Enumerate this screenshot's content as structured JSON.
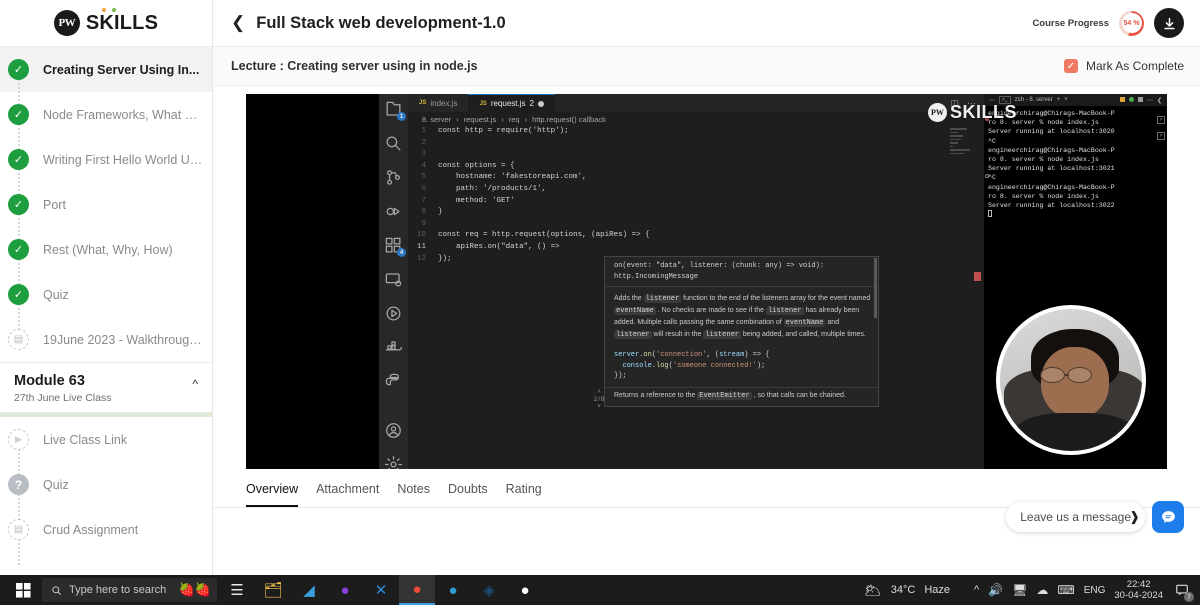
{
  "brand": {
    "mark": "PW",
    "name": "SKILLS"
  },
  "sidebar": {
    "lessons": [
      {
        "label": "Creating Server Using In...",
        "state": "done",
        "active": true
      },
      {
        "label": "Node Frameworks, What & W...",
        "state": "done",
        "active": false
      },
      {
        "label": "Writing First Hello World Usin...",
        "state": "done",
        "active": false
      },
      {
        "label": "Port",
        "state": "done",
        "active": false
      },
      {
        "label": "Rest (What, Why, How)",
        "state": "done",
        "active": false
      },
      {
        "label": "Quiz",
        "state": "done",
        "active": false
      },
      {
        "label": "19June 2023 - Walkthrough...",
        "state": "doc",
        "active": false
      }
    ],
    "module": {
      "title": "Module 63",
      "subtitle": "27th June Live Class",
      "collapse_icon": "chevron-up-icon"
    },
    "module_items": [
      {
        "label": "Live Class Link",
        "state": "play"
      },
      {
        "label": "Quiz",
        "state": "quiz"
      },
      {
        "label": "Crud Assignment",
        "state": "doc"
      }
    ]
  },
  "topbar": {
    "back_icon": "chevron-left-icon",
    "course_title": "Full Stack web development-1.0",
    "progress_label": "Course Progress",
    "progress_value": "54 %",
    "progress_percent": 54,
    "progress_color": "#e8543f",
    "download_icon": "download-icon"
  },
  "lecturebar": {
    "text": "Lecture : Creating server using in node.js",
    "mark_label": "Mark As Complete",
    "mark_checked": true,
    "mark_color": "#ef7a63"
  },
  "video": {
    "activity_icons": [
      {
        "name": "explorer-icon",
        "badge": "1"
      },
      {
        "name": "search-icon",
        "badge": ""
      },
      {
        "name": "source-control-icon",
        "badge": ""
      },
      {
        "name": "run-debug-icon",
        "badge": ""
      },
      {
        "name": "extensions-icon",
        "badge": "4"
      },
      {
        "name": "remote-explorer-icon",
        "badge": ""
      },
      {
        "name": "testing-icon",
        "badge": ""
      },
      {
        "name": "docker-icon",
        "badge": ""
      },
      {
        "name": "python-icon",
        "badge": ""
      }
    ],
    "activity_bottom": [
      {
        "name": "account-icon"
      },
      {
        "name": "settings-gear-icon"
      }
    ],
    "editor_tabs": [
      {
        "label": "index.js",
        "icon": "js-file-icon",
        "active": false,
        "dirty": false,
        "count": ""
      },
      {
        "label": "request.js",
        "icon": "js-file-icon",
        "active": true,
        "dirty": true,
        "count": "2"
      }
    ],
    "editor_actions": [
      {
        "name": "split-editor-icon",
        "glyph": "◫"
      },
      {
        "name": "more-actions-icon",
        "glyph": "⋯"
      }
    ],
    "breadcrumb": [
      "8. server",
      "request.js",
      "req",
      "http.request() callback"
    ],
    "code_lines": [
      {
        "n": "1",
        "text": "const http = require('http');"
      },
      {
        "n": "2",
        "text": ""
      },
      {
        "n": "3",
        "text": ""
      },
      {
        "n": "4",
        "text": "const options = {"
      },
      {
        "n": "5",
        "text": "    hostname: 'fakestoreapi.com',"
      },
      {
        "n": "6",
        "text": "    path: '/products/1',"
      },
      {
        "n": "7",
        "text": "    method: 'GET'"
      },
      {
        "n": "8",
        "text": "}"
      },
      {
        "n": "9",
        "text": ""
      },
      {
        "n": "10",
        "text": "const req = http.request(options, (apiRes) => {"
      },
      {
        "n": "11",
        "text": "    apiRes.on(\"data\", () => "
      },
      {
        "n": "12",
        "text": "});"
      }
    ],
    "tooltip": {
      "signature": "on(event: \"data\", listener: (chunk: any) => void):",
      "signature2": "http.IncomingMessage",
      "description": "Adds the listener function to the end of the listeners array for the event named eventName . No checks are made to see if the listener has already been added. Multiple calls passing the same combination of eventName and listener will result in the listener being added, and called, multiple times.",
      "example_line1": "server.on('connection', (stream) => {",
      "example_line2": "  console.log('someone connected!');",
      "example_line3": "});",
      "footer": "Returns a reference to the EventEmitter , so that calls can be chained.",
      "pager": "2/8"
    },
    "terminal": {
      "title": "zsh - 8. server",
      "prompt_icon": "terminal-icon",
      "add_icon": "plus-icon",
      "lines": [
        "engineerchirag@Chirags-MacBook-P",
        "ro 8. server % node index.js",
        "Server running at localhost:3020",
        "^C",
        "engineerchirag@Chirags-MacBook-P",
        "ro 8. server % node index.js",
        "Server running at localhost:3021",
        "^C",
        "engineerchirag@Chirags-MacBook-P",
        "ro 8. server % node index.js",
        "Server running at localhost:3022"
      ]
    },
    "watermark": {
      "mark": "PW",
      "text": "SKILLS"
    }
  },
  "content_tabs": [
    {
      "label": "Overview",
      "active": true
    },
    {
      "label": "Attachment",
      "active": false
    },
    {
      "label": "Notes",
      "active": false
    },
    {
      "label": "Doubts",
      "active": false
    },
    {
      "label": "Rating",
      "active": false
    }
  ],
  "chat": {
    "message": "Leave us a message",
    "arrow": "❱",
    "icon": "chat-bubble-icon",
    "color": "#1d7dea"
  },
  "taskbar": {
    "start_icon": "windows-start-icon",
    "search_placeholder": "Type here to search",
    "search_icon": "search-icon",
    "decor_icon": "strawberry-icon",
    "icons": [
      {
        "name": "task-view-icon",
        "glyph": "☰",
        "active": false
      },
      {
        "name": "file-explorer-icon",
        "glyph": "🗂",
        "active": false
      },
      {
        "name": "vscode-insiders-icon",
        "glyph": "◢",
        "active": false
      },
      {
        "name": "github-desktop-icon",
        "glyph": "●",
        "active": false
      },
      {
        "name": "vscode-icon",
        "glyph": "✕",
        "active": false
      },
      {
        "name": "chrome-icon",
        "glyph": "●",
        "active": true
      },
      {
        "name": "edge-icon",
        "glyph": "●",
        "active": false
      },
      {
        "name": "postman-icon",
        "glyph": "◈",
        "active": false
      },
      {
        "name": "mongodb-icon",
        "glyph": "●",
        "active": false
      }
    ],
    "weather_icon": "haze-icon",
    "weather_temp": "34°C",
    "weather_desc": "Haze",
    "tray_icons": [
      {
        "name": "show-hidden-icons-chevron",
        "glyph": "∧"
      },
      {
        "name": "volume-icon",
        "glyph": "🔊"
      },
      {
        "name": "network-icon",
        "glyph": "🖥"
      },
      {
        "name": "onedrive-icon",
        "glyph": "☁"
      },
      {
        "name": "keyboard-icon",
        "glyph": "⌨"
      }
    ],
    "language": "ENG",
    "time": "22:42",
    "date": "30-04-2024",
    "notification_icon": "action-center-icon",
    "notification_count": "7"
  }
}
